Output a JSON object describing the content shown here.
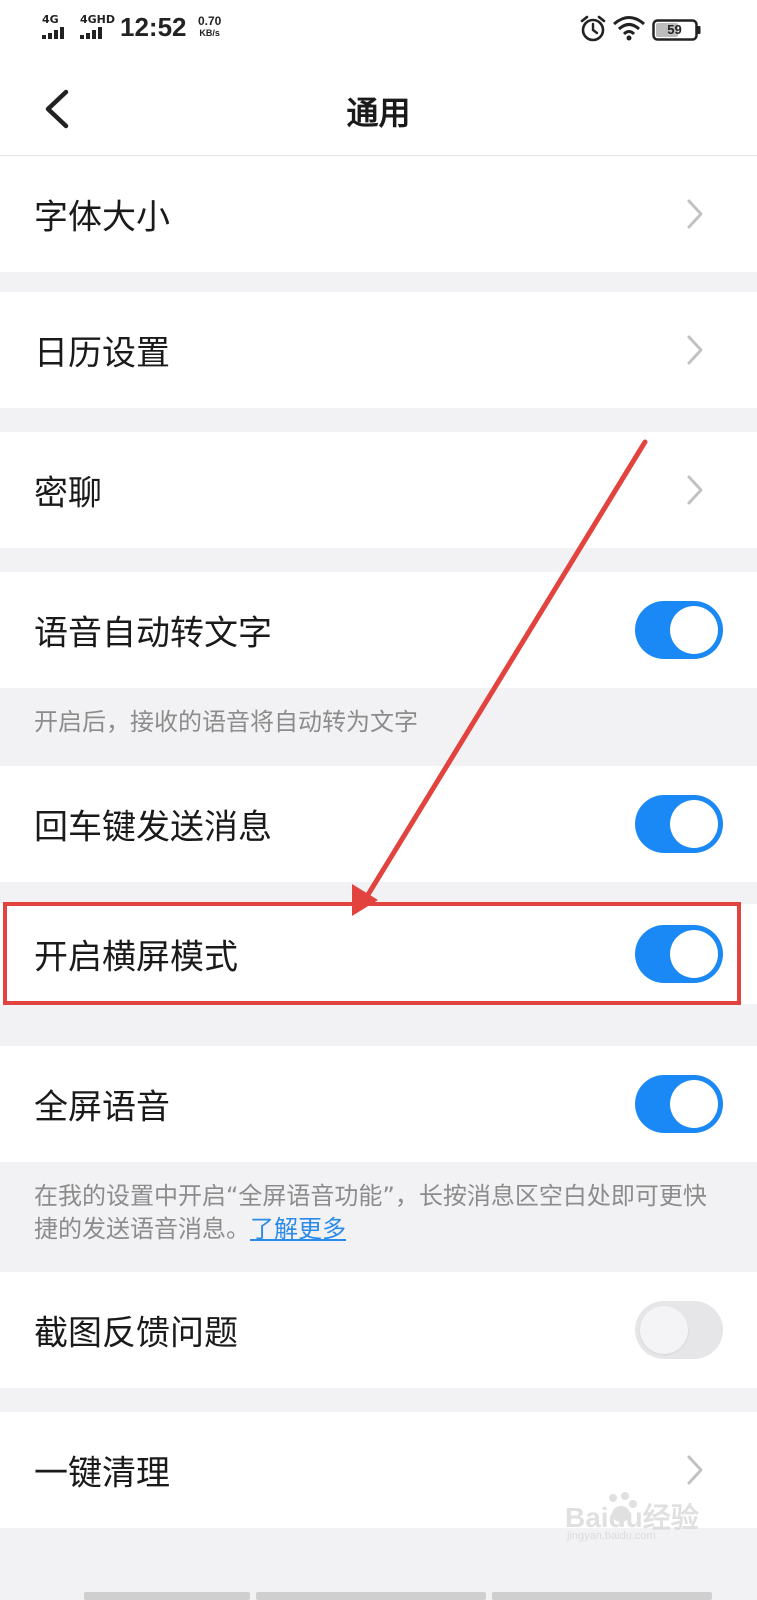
{
  "status_bar": {
    "signal1_label": "4G",
    "signal2_label": "4GHD",
    "time": "12:52",
    "net_speed_value": "0.70",
    "net_speed_unit": "KB/s",
    "battery": "59",
    "icons": [
      "alarm-icon",
      "wifi-icon",
      "battery-icon"
    ]
  },
  "header": {
    "title": "通用",
    "back_icon": "chevron-left-icon"
  },
  "settings": {
    "font_size": {
      "label": "字体大小"
    },
    "calendar": {
      "label": "日历设置"
    },
    "secret_chat": {
      "label": "密聊"
    },
    "voice_to_text": {
      "label": "语音自动转文字",
      "enabled": true,
      "hint": "开启后，接收的语音将自动转为文字"
    },
    "enter_to_send": {
      "label": "回车键发送消息",
      "enabled": true
    },
    "landscape": {
      "label": "开启横屏模式",
      "enabled": true
    },
    "fullscreen_voice": {
      "label": "全屏语音",
      "enabled": true,
      "hint": "在我的设置中开启“全屏语音功能”，长按消息区空白处即可更快捷的发送语音消息。",
      "hint_link": "了解更多"
    },
    "screenshot_feedback": {
      "label": "截图反馈问题",
      "enabled": false
    },
    "one_click_clean": {
      "label": "一键清理"
    }
  },
  "watermark": {
    "main": "Baidu经验",
    "sub": "jingyan.baidu.com"
  },
  "colors": {
    "toggle_on": "#1a88f5",
    "toggle_off": "#e6e6e8",
    "link": "#2a8ce8",
    "annotation": "#e2433e",
    "page_bg": "#f2f2f4"
  }
}
